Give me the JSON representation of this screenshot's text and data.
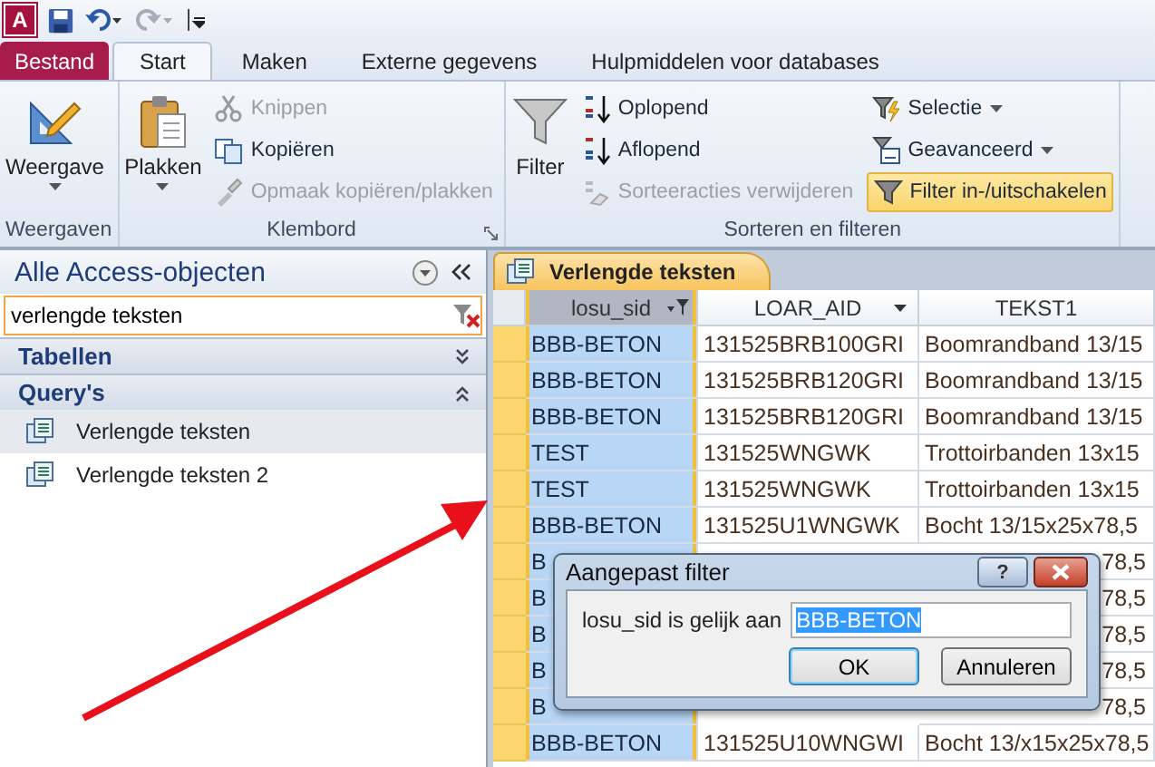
{
  "quick_access": {
    "logo_letter": "A"
  },
  "tabs": [
    {
      "label": "Bestand",
      "kind": "file",
      "selected": false
    },
    {
      "label": "Start",
      "kind": "tab",
      "selected": true
    },
    {
      "label": "Maken",
      "kind": "tab",
      "selected": false
    },
    {
      "label": "Externe gegevens",
      "kind": "tab",
      "selected": false
    },
    {
      "label": "Hulpmiddelen voor databases",
      "kind": "tab",
      "selected": false
    }
  ],
  "ribbon": {
    "groups": [
      {
        "label": "Weergaven",
        "launcher": false,
        "large": [
          {
            "label": "Weergave",
            "dropdown": true
          }
        ]
      },
      {
        "label": "Klembord",
        "launcher": true,
        "large": [
          {
            "label": "Plakken",
            "dropdown": true
          }
        ],
        "columns": [
          [
            {
              "label": "Knippen",
              "disabled": true,
              "active": false,
              "dropdown": false
            },
            {
              "label": "Kopiëren",
              "disabled": false,
              "active": false,
              "dropdown": false
            },
            {
              "label": "Opmaak kopiëren/plakken",
              "disabled": true,
              "active": false,
              "dropdown": false
            }
          ]
        ]
      },
      {
        "label": "Sorteren en filteren",
        "launcher": false,
        "large": [
          {
            "label": "Filter",
            "dropdown": false
          }
        ],
        "columns": [
          [
            {
              "label": "Oplopend",
              "disabled": false,
              "active": false,
              "dropdown": false
            },
            {
              "label": "Aflopend",
              "disabled": false,
              "active": false,
              "dropdown": false
            },
            {
              "label": "Sorteeracties verwijderen",
              "disabled": true,
              "active": false,
              "dropdown": false
            }
          ],
          [
            {
              "label": "Selectie",
              "disabled": false,
              "active": false,
              "dropdown": true
            },
            {
              "label": "Geavanceerd",
              "disabled": false,
              "active": false,
              "dropdown": true
            },
            {
              "label": "Filter in-/uitschakelen",
              "disabled": false,
              "active": true,
              "dropdown": false
            }
          ]
        ]
      }
    ]
  },
  "nav_pane": {
    "title": "Alle Access-objecten",
    "search": {
      "value": "verlengde teksten"
    },
    "sections": [
      {
        "label": "Tabellen",
        "expanded": false
      },
      {
        "label": "Query's",
        "expanded": true,
        "items": [
          {
            "label": "Verlengde teksten",
            "selected": true
          },
          {
            "label": "Verlengde teksten 2",
            "selected": false
          }
        ]
      }
    ]
  },
  "document_tab": {
    "label": "Verlengde teksten"
  },
  "table": {
    "columns": [
      {
        "label": "losu_sid",
        "filtered": true,
        "selected": true
      },
      {
        "label": "LOAR_AID",
        "filtered": false,
        "selected": false
      },
      {
        "label": "TEKST1",
        "filtered": false,
        "selected": false
      }
    ],
    "rows": [
      {
        "losu_sid": "BBB-BETON",
        "loar_aid": "131525BRB100GRI",
        "tekst1": "Boomrandband 13/15"
      },
      {
        "losu_sid": "BBB-BETON",
        "loar_aid": "131525BRB120GRI",
        "tekst1": "Boomrandband 13/15"
      },
      {
        "losu_sid": "BBB-BETON",
        "loar_aid": "131525BRB120GRI",
        "tekst1": "Boomrandband 13/15"
      },
      {
        "losu_sid": "TEST",
        "loar_aid": "131525WNGWK",
        "tekst1": "Trottoirbanden 13x15"
      },
      {
        "losu_sid": "TEST",
        "loar_aid": "131525WNGWK",
        "tekst1": "Trottoirbanden 13x15"
      },
      {
        "losu_sid": "BBB-BETON",
        "loar_aid": "131525U1WNGWK",
        "tekst1": "Bocht 13/15x25x78,5"
      },
      {
        "losu_sid": "B",
        "tekst1": "78,5"
      },
      {
        "losu_sid": "B",
        "tekst1": "78,5"
      },
      {
        "losu_sid": "B",
        "tekst1": "78,5"
      },
      {
        "losu_sid": "B",
        "tekst1": "78,5"
      },
      {
        "losu_sid": "B",
        "tekst1": "78,5"
      },
      {
        "losu_sid": "BBB-BETON",
        "loar_aid": "131525U10WNGWI",
        "tekst1": "Bocht 13/x15x25x78,5"
      }
    ]
  },
  "dialog": {
    "title": "Aangepast filter",
    "help": "?",
    "label": "losu_sid is gelijk aan",
    "value": "BBB-BETON",
    "buttons": [
      {
        "label": "OK",
        "default": true
      },
      {
        "label": "Annuleren",
        "default": false
      }
    ]
  }
}
